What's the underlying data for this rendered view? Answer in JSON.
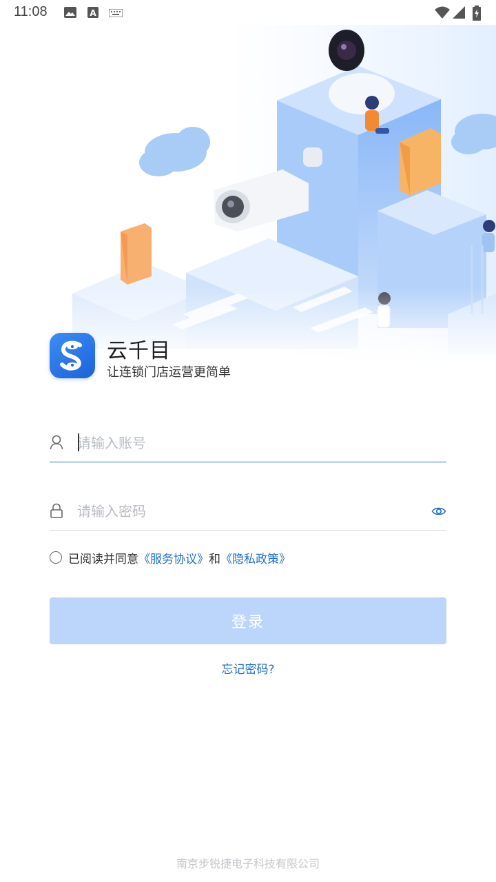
{
  "status_bar": {
    "time": "11:08",
    "icons_left": [
      "image-icon",
      "a-letter-icon",
      "keyboard-icon"
    ],
    "icons_right": [
      "wifi-icon",
      "signal-icon",
      "battery-charging-icon"
    ]
  },
  "brand": {
    "app_name": "云千目",
    "slogan": "让连锁门店运营更简单",
    "logo": "s-logo-icon",
    "accent_color": "#1a63d8"
  },
  "form": {
    "account_placeholder": "请输入账号",
    "account_value": "",
    "password_placeholder": "请输入密码",
    "password_value": "",
    "agree_prefix": "已阅读并同意",
    "service_link": "《服务协议》",
    "and_text": "和",
    "privacy_link": "《隐私政策》",
    "agree_checked": false,
    "login_label": "登录",
    "forgot_label": "忘记密码?",
    "link_color": "#1f6fc8",
    "button_color": "#bcd6fb"
  },
  "footer": {
    "company": "南京步锐捷电子科技有限公司"
  }
}
